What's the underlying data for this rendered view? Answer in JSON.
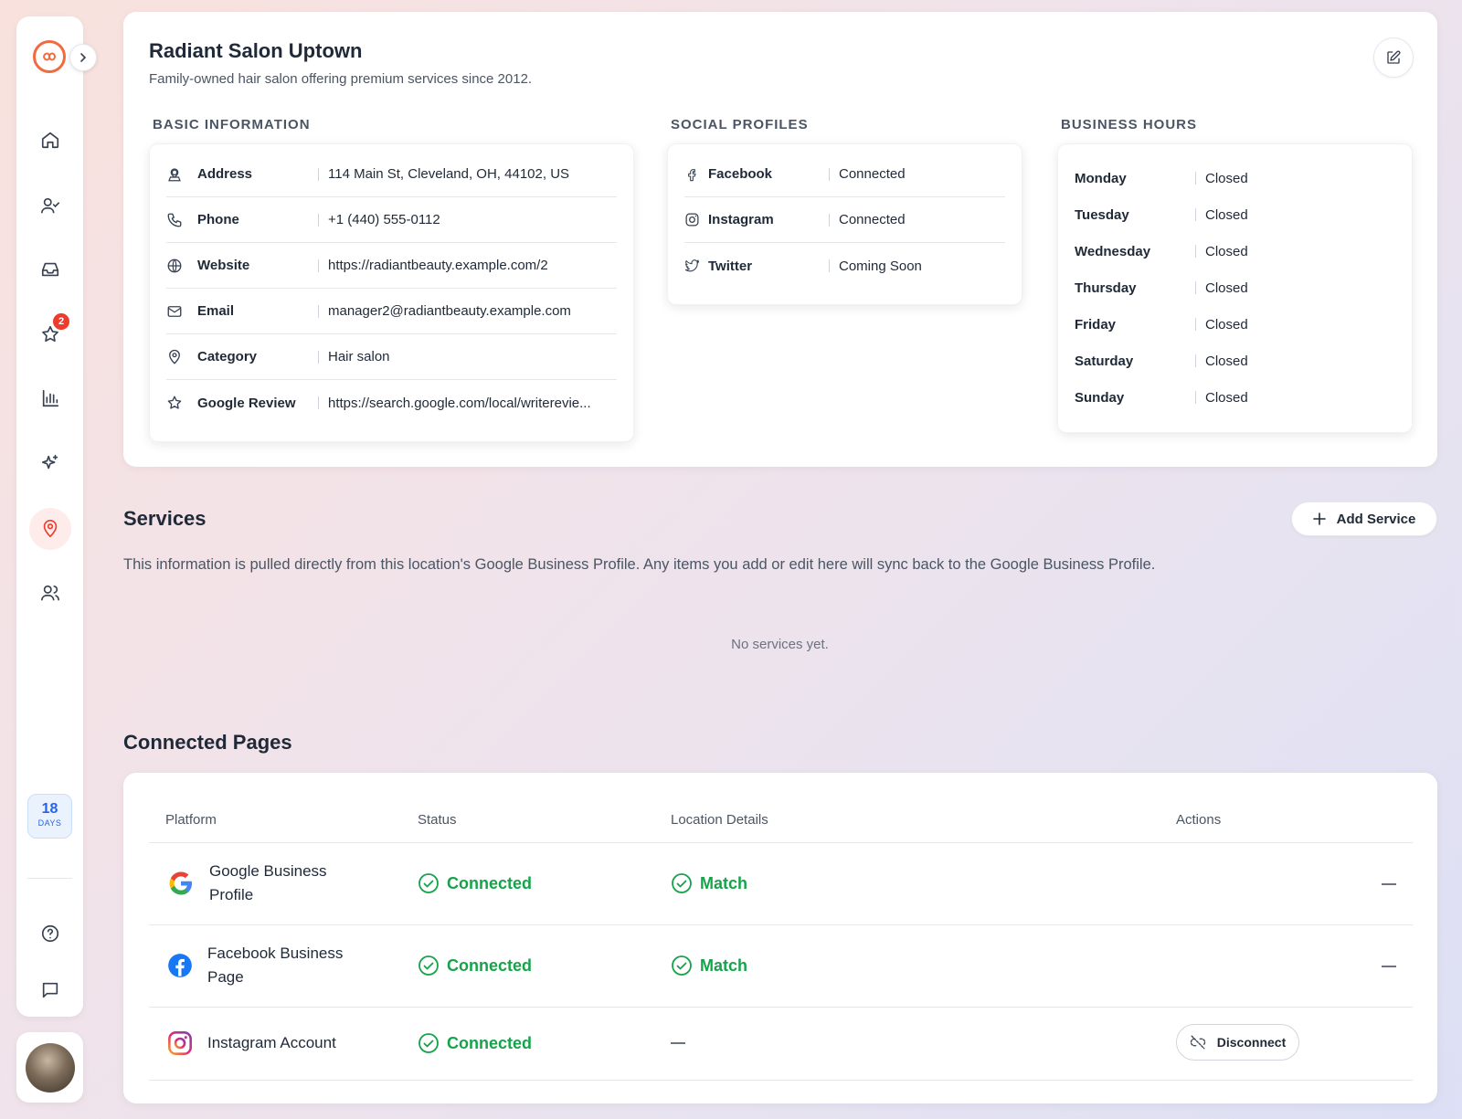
{
  "sidebar": {
    "trial_days": "18",
    "trial_label": "DAYS",
    "reviews_badge": "2"
  },
  "business": {
    "title": "Radiant Salon Uptown",
    "description": "Family-owned hair salon offering premium services since 2012."
  },
  "basic_info": {
    "heading": "BASIC INFORMATION",
    "rows": [
      {
        "label": "Address",
        "value": "114 Main St, Cleveland, OH, 44102, US",
        "icon": "address-pin-icon"
      },
      {
        "label": "Phone",
        "value": "+1 (440) 555-0112",
        "icon": "phone-icon"
      },
      {
        "label": "Website",
        "value": "https://radiantbeauty.example.com/2",
        "icon": "globe-icon"
      },
      {
        "label": "Email",
        "value": "manager2@radiantbeauty.example.com",
        "icon": "mail-icon"
      },
      {
        "label": "Category",
        "value": "Hair salon",
        "icon": "location-pin-icon"
      },
      {
        "label": "Google Review",
        "value": "https://search.google.com/local/writerevie...",
        "icon": "star-icon"
      }
    ]
  },
  "social": {
    "heading": "SOCIAL PROFILES",
    "rows": [
      {
        "label": "Facebook",
        "value": "Connected"
      },
      {
        "label": "Instagram",
        "value": "Connected"
      },
      {
        "label": "Twitter",
        "value": "Coming Soon"
      }
    ]
  },
  "hours": {
    "heading": "BUSINESS HOURS",
    "rows": [
      {
        "day": "Monday",
        "value": "Closed"
      },
      {
        "day": "Tuesday",
        "value": "Closed"
      },
      {
        "day": "Wednesday",
        "value": "Closed"
      },
      {
        "day": "Thursday",
        "value": "Closed"
      },
      {
        "day": "Friday",
        "value": "Closed"
      },
      {
        "day": "Saturday",
        "value": "Closed"
      },
      {
        "day": "Sunday",
        "value": "Closed"
      }
    ]
  },
  "services": {
    "title": "Services",
    "add_label": "Add Service",
    "description": "This information is pulled directly from this location's Google Business Profile. Any items you add or edit here will sync back to the Google Business Profile.",
    "empty": "No services yet."
  },
  "connected": {
    "title": "Connected Pages",
    "headers": {
      "platform": "Platform",
      "status": "Status",
      "location": "Location Details",
      "actions": "Actions"
    },
    "rows": [
      {
        "platform": "Google Business Profile",
        "status": "Connected",
        "location": "Match"
      },
      {
        "platform": "Facebook Business Page",
        "status": "Connected",
        "location": "Match"
      },
      {
        "platform": "Instagram Account",
        "status": "Connected",
        "action": "Disconnect"
      }
    ]
  },
  "colors": {
    "accent": "#f26a3d",
    "success": "#16a34a",
    "badge": "#ef3b2c",
    "trial": "#2563eb"
  }
}
